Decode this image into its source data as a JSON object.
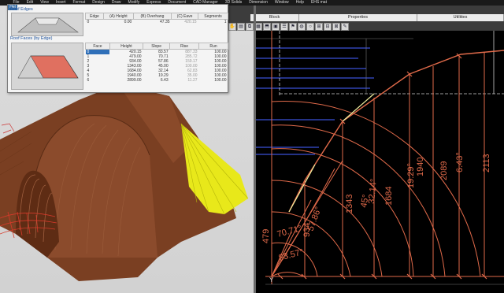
{
  "menu": [
    "File",
    "Edit",
    "View",
    "Insert",
    "Format",
    "Design",
    "Draw",
    "Modify",
    "Express",
    "Document",
    "CAD Manager",
    "3D Solids",
    "Dimension",
    "Window",
    "Help",
    "EHS mat"
  ],
  "ribbon": {
    "tabs": [
      "Block",
      "Properties",
      "Utilities"
    ]
  },
  "dialog": {
    "tab_button": "Hel",
    "edges_label": "Roof Edges",
    "faces_label": "Roof Faces (by Edge)",
    "edges_columns": [
      "Edge",
      "(A) Height",
      "(B) Overhang",
      "(C) Eave",
      "Segments"
    ],
    "edges_rows": [
      [
        "0",
        "0.00",
        "47.35",
        "420.15",
        "1"
      ]
    ],
    "faces_columns": [
      "Face",
      "Height",
      "Slope",
      "Rise",
      "Run"
    ],
    "faces_rows": [
      [
        "0",
        "420.15",
        "83.57",
        "887.33",
        "100.00"
      ],
      [
        "1",
        "479.00",
        "70.71",
        "285.72",
        "100.00"
      ],
      [
        "2",
        "934.00",
        "57.86",
        "159.17",
        "100.00"
      ],
      [
        "3",
        "1343.00",
        "45.00",
        "100.00",
        "100.00"
      ],
      [
        "4",
        "1684.00",
        "32.14",
        "62.83",
        "100.00"
      ],
      [
        "5",
        "1940.00",
        "19.29",
        "35.00",
        "100.00"
      ],
      [
        "6",
        "2899.00",
        "6.43",
        "11.27",
        "100.00"
      ]
    ]
  },
  "cad": {
    "axis_label": "Y",
    "slopes": [
      "83.57°",
      "70.71°",
      "57.86°",
      "45°",
      "32.14°",
      "19.29°",
      "6.43°"
    ],
    "heights": [
      "479",
      "934",
      "1343",
      "1684",
      "1940",
      "2089",
      "2113"
    ]
  },
  "colors": {
    "roof_brown": "#7a3f22",
    "cad_orange": "#e06a4a",
    "cad_blue": "#3b4fd6",
    "yellow_cone": "#e8e81a"
  }
}
